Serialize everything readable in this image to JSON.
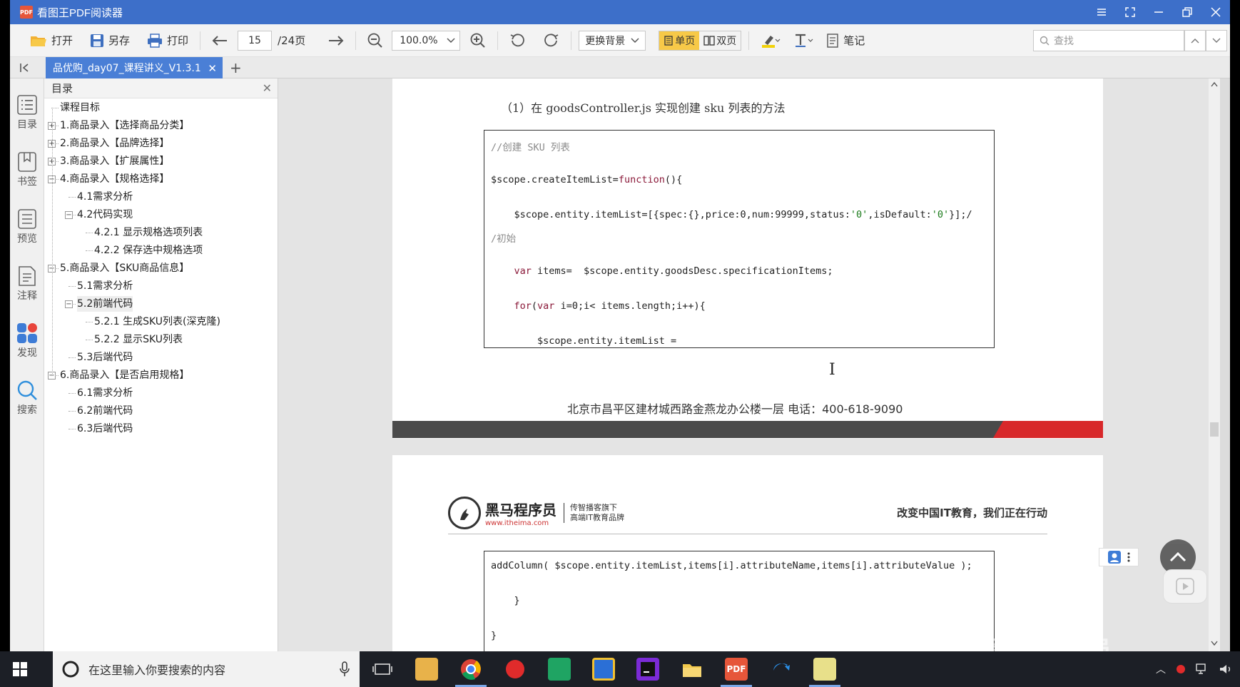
{
  "window": {
    "title": "看图王PDF阅读器",
    "app_icon_text": "PDF"
  },
  "toolbar": {
    "open_label": "打开",
    "save_as_label": "另存",
    "print_label": "打印",
    "current_page": "15",
    "total_pages": "/24页",
    "zoom_level": "100.0%",
    "background_label": "更换背景",
    "single_page_label": "单页",
    "double_page_label": "双页",
    "notes_label": "笔记",
    "search_placeholder": "查找"
  },
  "tabs": [
    {
      "label": "品优购_day07_课程讲义_V1.3.1",
      "active": true
    }
  ],
  "sidebar_icons": [
    {
      "label": "目录",
      "icon": "toc-icon"
    },
    {
      "label": "书签",
      "icon": "bookmark-icon"
    },
    {
      "label": "预览",
      "icon": "preview-icon"
    },
    {
      "label": "注释",
      "icon": "annotation-icon"
    },
    {
      "label": "发现",
      "icon": "discover-icon"
    },
    {
      "label": "搜索",
      "icon": "search-icon"
    }
  ],
  "toc": {
    "header": "目录",
    "items": [
      {
        "label": "课程目标",
        "level": 0,
        "expander": ""
      },
      {
        "label": "1.商品录入【选择商品分类】",
        "level": 0,
        "expander": "+"
      },
      {
        "label": "2.商品录入【品牌选择】",
        "level": 0,
        "expander": "+"
      },
      {
        "label": "3.商品录入【扩展属性】",
        "level": 0,
        "expander": "+"
      },
      {
        "label": "4.商品录入【规格选择】",
        "level": 0,
        "expander": "-"
      },
      {
        "label": "4.1需求分析",
        "level": 1,
        "expander": ""
      },
      {
        "label": "4.2代码实现",
        "level": 1,
        "expander": "-"
      },
      {
        "label": "4.2.1 显示规格选项列表",
        "level": 2,
        "expander": ""
      },
      {
        "label": "4.2.2 保存选中规格选项",
        "level": 2,
        "expander": ""
      },
      {
        "label": "5.商品录入【SKU商品信息】",
        "level": 0,
        "expander": "-"
      },
      {
        "label": "5.1需求分析",
        "level": 1,
        "expander": ""
      },
      {
        "label": "5.2前端代码",
        "level": 1,
        "expander": "-"
      },
      {
        "label": "5.2.1 生成SKU列表(深克隆)",
        "level": 2,
        "expander": ""
      },
      {
        "label": "5.2.2 显示SKU列表",
        "level": 2,
        "expander": ""
      },
      {
        "label": "5.3后端代码",
        "level": 1,
        "expander": ""
      },
      {
        "label": "6.商品录入【是否启用规格】",
        "level": 0,
        "expander": "-"
      },
      {
        "label": "6.1需求分析",
        "level": 1,
        "expander": ""
      },
      {
        "label": "6.2前端代码",
        "level": 1,
        "expander": ""
      },
      {
        "label": "6.3后端代码",
        "level": 1,
        "expander": ""
      }
    ]
  },
  "document": {
    "heading": "（1）在 goodsController.js 实现创建 sku 列表的方法",
    "code_block_1": [
      {
        "text": "//创建 SKU 列表",
        "style": "cm"
      },
      {
        "text": "$scope.createItemList=function(){",
        "style": "plain"
      },
      {
        "text": "    $scope.entity.itemList=[{spec:{},price:0,num:99999,status:'0',isDefault:'0'}];/",
        "style": "plain"
      },
      {
        "text": "/初始",
        "style": "cm"
      },
      {
        "text": "    var items=  $scope.entity.goodsDesc.specificationItems;",
        "style": "plain"
      },
      {
        "text": "    for(var i=0;i< items.length;i++){",
        "style": "plain"
      },
      {
        "text": "        $scope.entity.itemList =",
        "style": "plain"
      }
    ],
    "footer_address": "北京市昌平区建材城西路金燕龙办公楼一层      电话：400-618-9090",
    "logo_title": "黑马程序员",
    "logo_url": "www.itheima.com",
    "logo_sub1": "传智播客旗下",
    "logo_sub2": "高端IT教育品牌",
    "slogan": "改变中国IT教育，我们正在行动",
    "code_block_2": [
      {
        "text": "addColumn( $scope.entity.itemList,items[i].attributeName,items[i].attributeValue );",
        "style": "plain"
      },
      {
        "text": "    }",
        "style": "plain"
      },
      {
        "text": "}",
        "style": "plain"
      }
    ]
  },
  "taskbar": {
    "search_placeholder": "在这里输入你要搜索的内容",
    "watermark": "黑马程序员"
  },
  "colors": {
    "titlebar": "#3d6fc9",
    "tab_active": "#4a7fd6",
    "accent_toggle": "#f7c948",
    "footer_red": "#d8282a",
    "taskbar": "#1c1f26"
  }
}
